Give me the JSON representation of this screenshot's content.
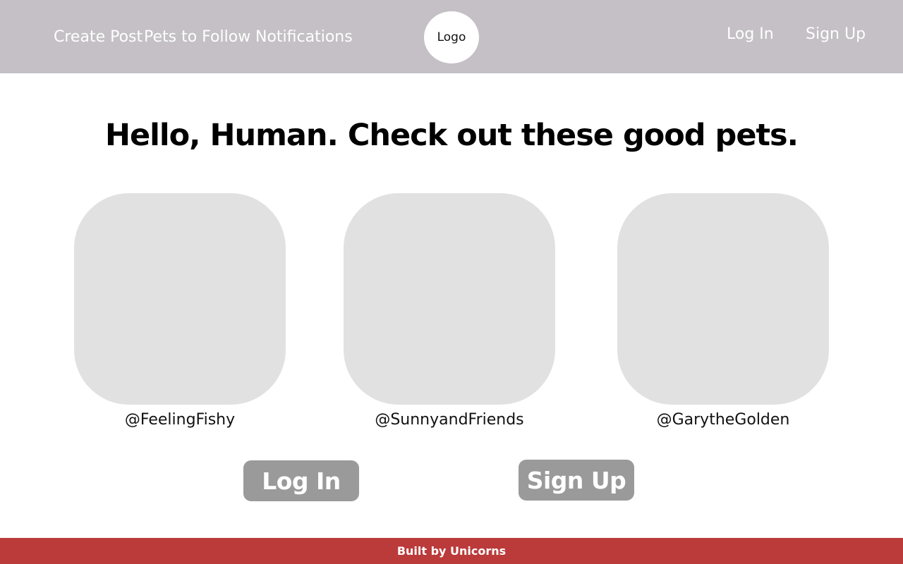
{
  "header": {
    "nav_left": [
      "Create Post",
      "Pets to Follow",
      "Notifications"
    ],
    "logo_text": "Logo",
    "login_label": "Log In",
    "signup_label": "Sign Up"
  },
  "main": {
    "headline": "Hello, Human. Check out these good pets.",
    "pets": [
      {
        "handle": "@FeelingFishy"
      },
      {
        "handle": "@SunnyandFriends"
      },
      {
        "handle": "@GarytheGolden"
      }
    ],
    "login_button": "Log In",
    "signup_button": "Sign Up"
  },
  "footer": {
    "text": "Built by Unicorns"
  },
  "colors": {
    "header_bg": "#c4c0c5",
    "card_bg": "#e1e1e1",
    "button_bg": "#9a9a9a",
    "footer_bg": "#bb3a3a"
  }
}
